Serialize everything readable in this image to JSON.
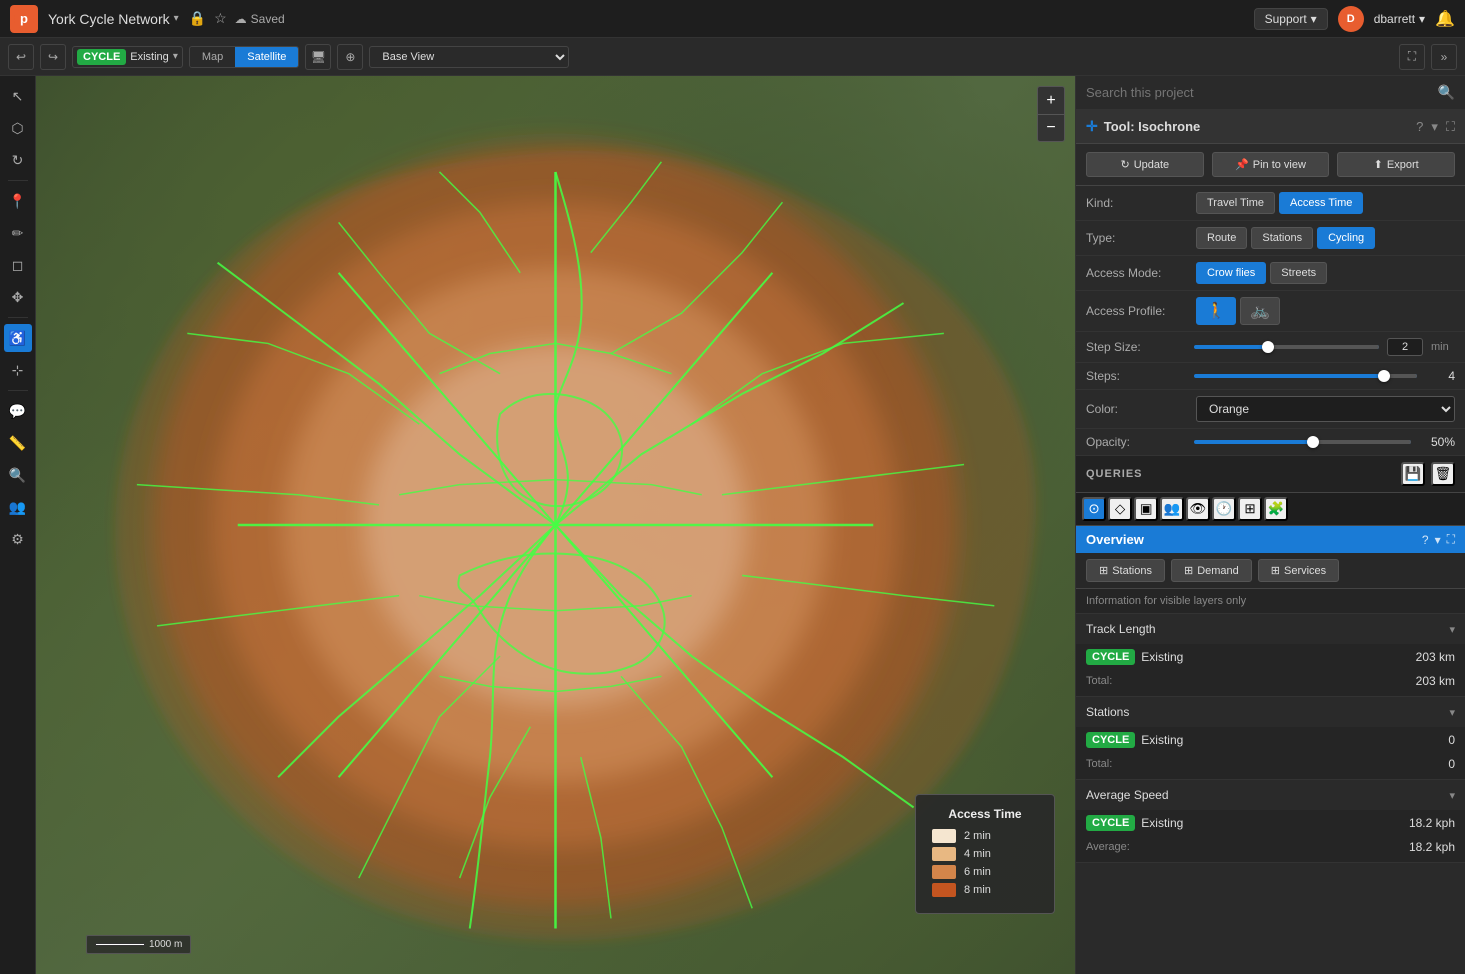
{
  "app": {
    "logo": "p",
    "project_name": "York Cycle Network",
    "saved_status": "Saved",
    "support_label": "Support",
    "user_initial": "D",
    "user_name": "dbarrett"
  },
  "toolbar": {
    "undo": "↩",
    "redo": "↪",
    "cycle_tag": "CYCLE",
    "layer_name": "Existing",
    "map_type_map": "Map",
    "map_type_satellite": "Satellite",
    "view_label": "Base View",
    "fullscreen": "⛶",
    "next": "»"
  },
  "left_tools": [
    {
      "name": "select",
      "icon": "↖",
      "active": false
    },
    {
      "name": "shapes",
      "icon": "⬡",
      "active": false
    },
    {
      "name": "refresh",
      "icon": "↻",
      "active": false
    },
    {
      "name": "pin",
      "icon": "📍",
      "active": false
    },
    {
      "name": "pen",
      "icon": "✏",
      "active": false
    },
    {
      "name": "eraser",
      "icon": "◻",
      "active": false
    },
    {
      "name": "move",
      "icon": "✥",
      "active": false
    },
    {
      "name": "accessibility",
      "icon": "♿",
      "active": true
    },
    {
      "name": "node",
      "icon": "⊹",
      "active": false
    },
    {
      "name": "comment",
      "icon": "💬",
      "active": false
    },
    {
      "name": "measure",
      "icon": "📏",
      "active": false
    },
    {
      "name": "search",
      "icon": "🔍",
      "active": false
    },
    {
      "name": "user-group",
      "icon": "👥",
      "active": false
    },
    {
      "name": "settings",
      "icon": "⚙",
      "active": false
    }
  ],
  "search": {
    "placeholder": "Search this project"
  },
  "tool": {
    "title": "Tool: Isochrone",
    "update_label": "Update",
    "pin_label": "Pin to view",
    "export_label": "Export",
    "kind_label": "Kind:",
    "kind_travel": "Travel Time",
    "kind_access": "Access Time",
    "type_label": "Type:",
    "type_route": "Route",
    "type_stations": "Stations",
    "type_cycling": "Cycling",
    "access_mode_label": "Access Mode:",
    "access_crow": "Crow flies",
    "access_streets": "Streets",
    "access_profile_label": "Access Profile:",
    "step_size_label": "Step Size:",
    "step_size_value": "2",
    "step_size_unit": "min",
    "steps_label": "Steps:",
    "steps_value": "4",
    "color_label": "Color:",
    "color_value": "Orange",
    "opacity_label": "Opacity:",
    "opacity_value": "50%",
    "step_size_pct": 40,
    "steps_pct": 85,
    "opacity_pct": 55
  },
  "queries": {
    "title": "QUERIES"
  },
  "overview": {
    "title": "Overview",
    "tabs": [
      {
        "label": "Stations",
        "icon": "⊞",
        "active": false
      },
      {
        "label": "Demand",
        "icon": "⊞",
        "active": false
      },
      {
        "label": "Services",
        "icon": "⊞",
        "active": false
      }
    ],
    "info_text": "Information for visible layers only",
    "sections": [
      {
        "title": "Track Length",
        "rows": [
          {
            "tag": "CYCLE",
            "name": "Existing",
            "value": "203 km"
          }
        ],
        "total_label": "Total:",
        "total_value": "203 km"
      },
      {
        "title": "Stations",
        "rows": [
          {
            "tag": "CYCLE",
            "name": "Existing",
            "value": "0"
          }
        ],
        "total_label": "Total:",
        "total_value": "0"
      },
      {
        "title": "Average Speed",
        "rows": [
          {
            "tag": "CYCLE",
            "name": "Existing",
            "value": "18.2 kph"
          }
        ],
        "total_label": "Average:",
        "total_value": "18.2 kph"
      }
    ]
  },
  "legend": {
    "title": "Access Time",
    "items": [
      {
        "color": "#f5e6d0",
        "label": "2 min"
      },
      {
        "color": "#e8b882",
        "label": "4 min"
      },
      {
        "color": "#d4854a",
        "label": "6 min"
      },
      {
        "color": "#c45520",
        "label": "8 min"
      }
    ]
  },
  "scale": {
    "label": "1000 m"
  },
  "zoom": {
    "plus": "+",
    "minus": "−"
  },
  "colors": {
    "accent_blue": "#1a7bd6",
    "accent_green": "#22aa44",
    "accent_orange": "#e85d2f"
  }
}
